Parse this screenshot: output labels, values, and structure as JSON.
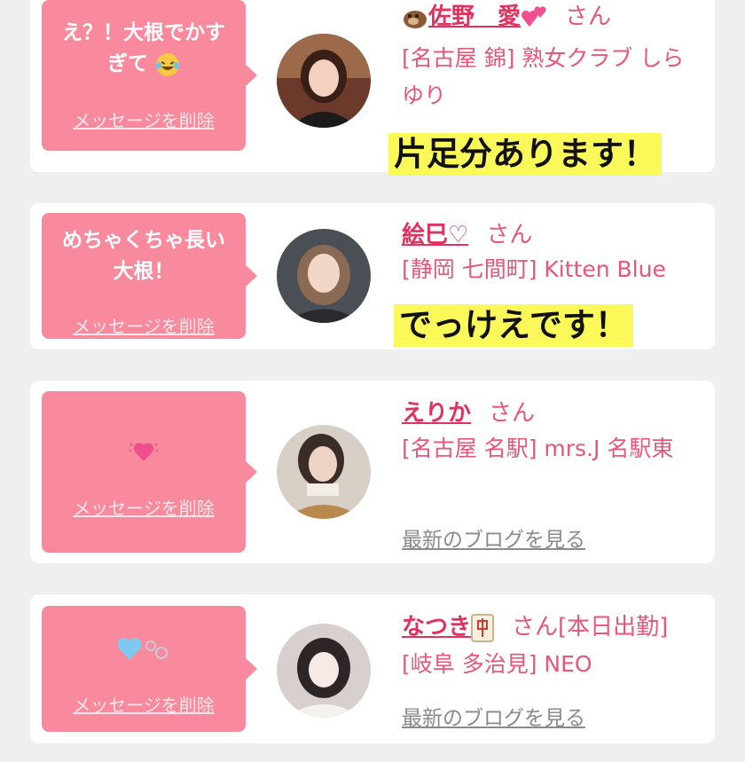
{
  "cards": [
    {
      "message": "え？！大根でかすぎて",
      "message_emoji": "laughing-tears-emoji",
      "delete_label": "メッセージを削除",
      "name": "佐野　愛",
      "name_emoji_prefix": "otter-emoji",
      "name_emoji_suffix": "two-hearts-emoji",
      "honorific": "さん",
      "shop": "[名古屋 錦] 熟女クラブ しらゆり",
      "caption": "片足分あります！"
    },
    {
      "message": "めちゃくちゃ長い大根！",
      "delete_label": "メッセージを削除",
      "name": "絵巳♡",
      "honorific": "さん",
      "shop": "[静岡 七間町] Kitten Blue",
      "caption": "でっけえです！"
    },
    {
      "message_emoji": "beating-heart-emoji",
      "delete_label": "メッセージを削除",
      "name": "えりか",
      "honorific": "さん",
      "shop": "[名古屋 名駅] mrs.J 名駅東",
      "blog_link": "最新のブログを見る"
    },
    {
      "message_emoji": "blue-heart-bubbles-emoji",
      "delete_label": "メッセージを削除",
      "name": "なつき",
      "name_emoji_suffix": "mahjong-tile-emoji",
      "honorific": "さん",
      "status": "[本日出勤]",
      "shop": "[岐阜 多治見] NEO",
      "blog_link": "最新のブログを見る"
    }
  ],
  "colors": {
    "bubble": "#f9899c",
    "name": "#e0325f",
    "text": "#e8567a",
    "highlight": "#fbf85a",
    "background": "#efefef"
  }
}
